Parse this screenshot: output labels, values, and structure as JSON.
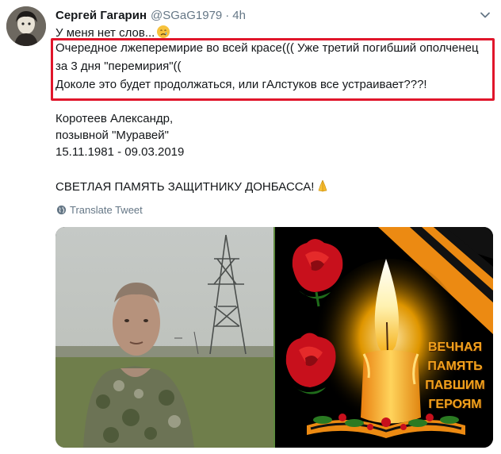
{
  "tweet": {
    "author_name": "Сергей Гагарин",
    "author_handle": "@SGaG1979",
    "separator": "·",
    "time": "4h",
    "caret_icon": "chevron-down-icon",
    "lines": {
      "intro": "У меня нет слов...",
      "highlight_1": "Очередное лжеперемирие во всей красе((( Уже третий погибший ополченец",
      "highlight_2": "за 3 дня \"перемирия\"((",
      "highlight_3": "Доколе это будет продолжаться, или гАлстуков все устраивает???!",
      "name": "Коротеев Александр,",
      "callsign": "позывной \"Муравей\"",
      "dates": "15.11.1981 - 09.03.2019",
      "memory": "СВЕТЛАЯ ПАМЯТЬ ЗАЩИТНИКУ ДОНБАССА!"
    },
    "intro_emoji": "crying-face-emoji",
    "memory_emoji": "folded-hands-emoji",
    "translate_label": "Translate Tweet",
    "translate_icon": "globe-icon",
    "highlight_color": "#e0162b",
    "memorial_text": {
      "line1": "ВЕЧНАЯ",
      "line2": "ПАМЯТЬ",
      "line3": "ПАВШИМ",
      "line4": "ГЕРОЯМ"
    }
  }
}
